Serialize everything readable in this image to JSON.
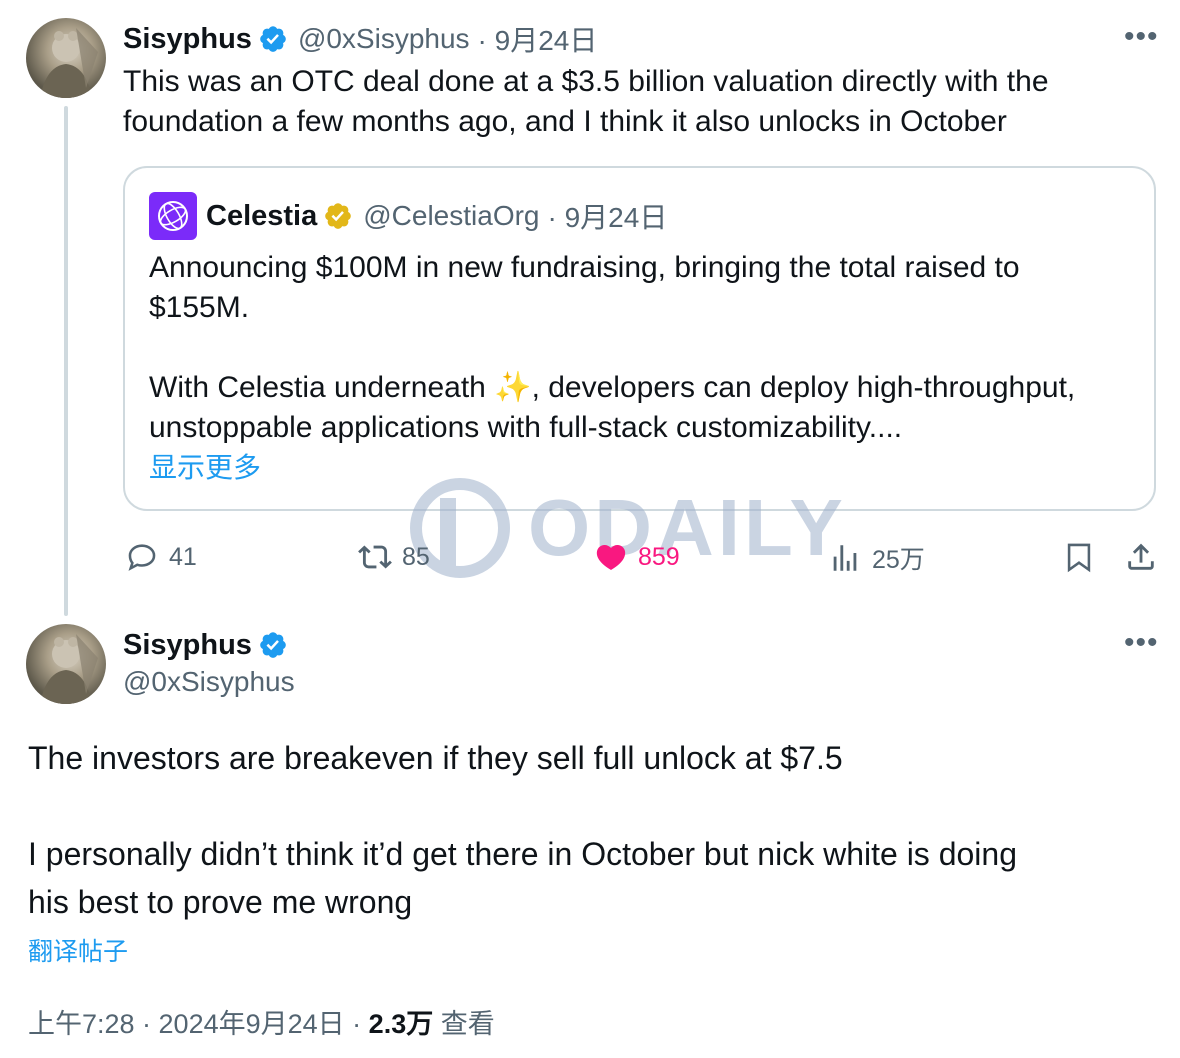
{
  "tweet1": {
    "name": "Sisyphus",
    "handle": "@0xSisyphus",
    "date": "· 9月24日",
    "more": "•••",
    "text_line1": "This was an OTC deal done at a $3.5 billion valuation directly with the",
    "text_line2": "foundation a few months ago, and I think it also unlocks in October"
  },
  "quote": {
    "name": "Celestia",
    "handle": "@CelestiaOrg",
    "date": "· 9月24日",
    "line1": "Announcing $100M in new fundraising, bringing the total raised to",
    "line2": "$155M.",
    "line3a": "With Celestia underneath ",
    "emoji": "✨",
    "line3b": ", developers can deploy high-throughput,",
    "line4": "unstoppable applications with full-stack customizability....",
    "show_more": "显示更多"
  },
  "actions": {
    "replies": "41",
    "reposts": "85",
    "likes": "859",
    "views": "25万"
  },
  "watermark": {
    "text": "ODAILY"
  },
  "tweet2": {
    "name": "Sisyphus",
    "handle": "@0xSisyphus",
    "more": "•••",
    "para1": "The investors are breakeven if they sell full unlock at $7.5",
    "para2_line1": "I personally didn’t think it’d get there in October but nick white is doing",
    "para2_line2": "his best to prove me wrong",
    "translate": "翻译帖子",
    "time": "上午7:28 · 2024年9月24日 ·",
    "views_count": "2.3万",
    "views_label": "查看"
  },
  "colors": {
    "accent": "#1d9bf0",
    "like": "#f91880",
    "muted": "#536471",
    "gold": "#e2b719",
    "celestia_purple": "#7b2bf9"
  }
}
